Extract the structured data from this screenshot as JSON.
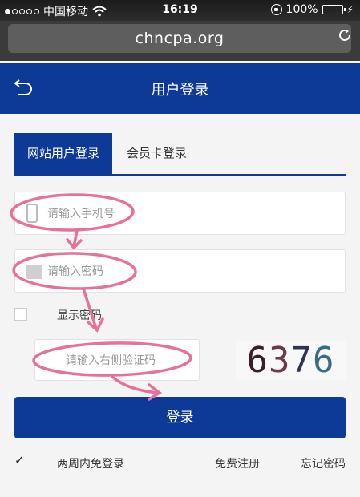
{
  "status_bar": {
    "carrier": "中国移动",
    "time": "16:19",
    "battery": "100%"
  },
  "browser": {
    "url": "chncpa.org"
  },
  "header": {
    "title": "用户登录"
  },
  "tabs": [
    {
      "label": "网站用户登录",
      "active": true
    },
    {
      "label": "会员卡登录",
      "active": false
    }
  ],
  "form": {
    "phone_placeholder": "请输入手机号",
    "password_placeholder": "请输入密码",
    "show_password_label": "显示密码",
    "captcha_placeholder": "请输入右侧验证码",
    "captcha_code": [
      "6",
      "3",
      "7",
      "6"
    ],
    "login_label": "登录",
    "remember_label": "两周内免登录",
    "register_label": "免费注册",
    "forgot_label": "忘记密码",
    "remember_checked": true
  },
  "colors": {
    "brand": "#0d3a96",
    "annotation": "#e8709a"
  }
}
